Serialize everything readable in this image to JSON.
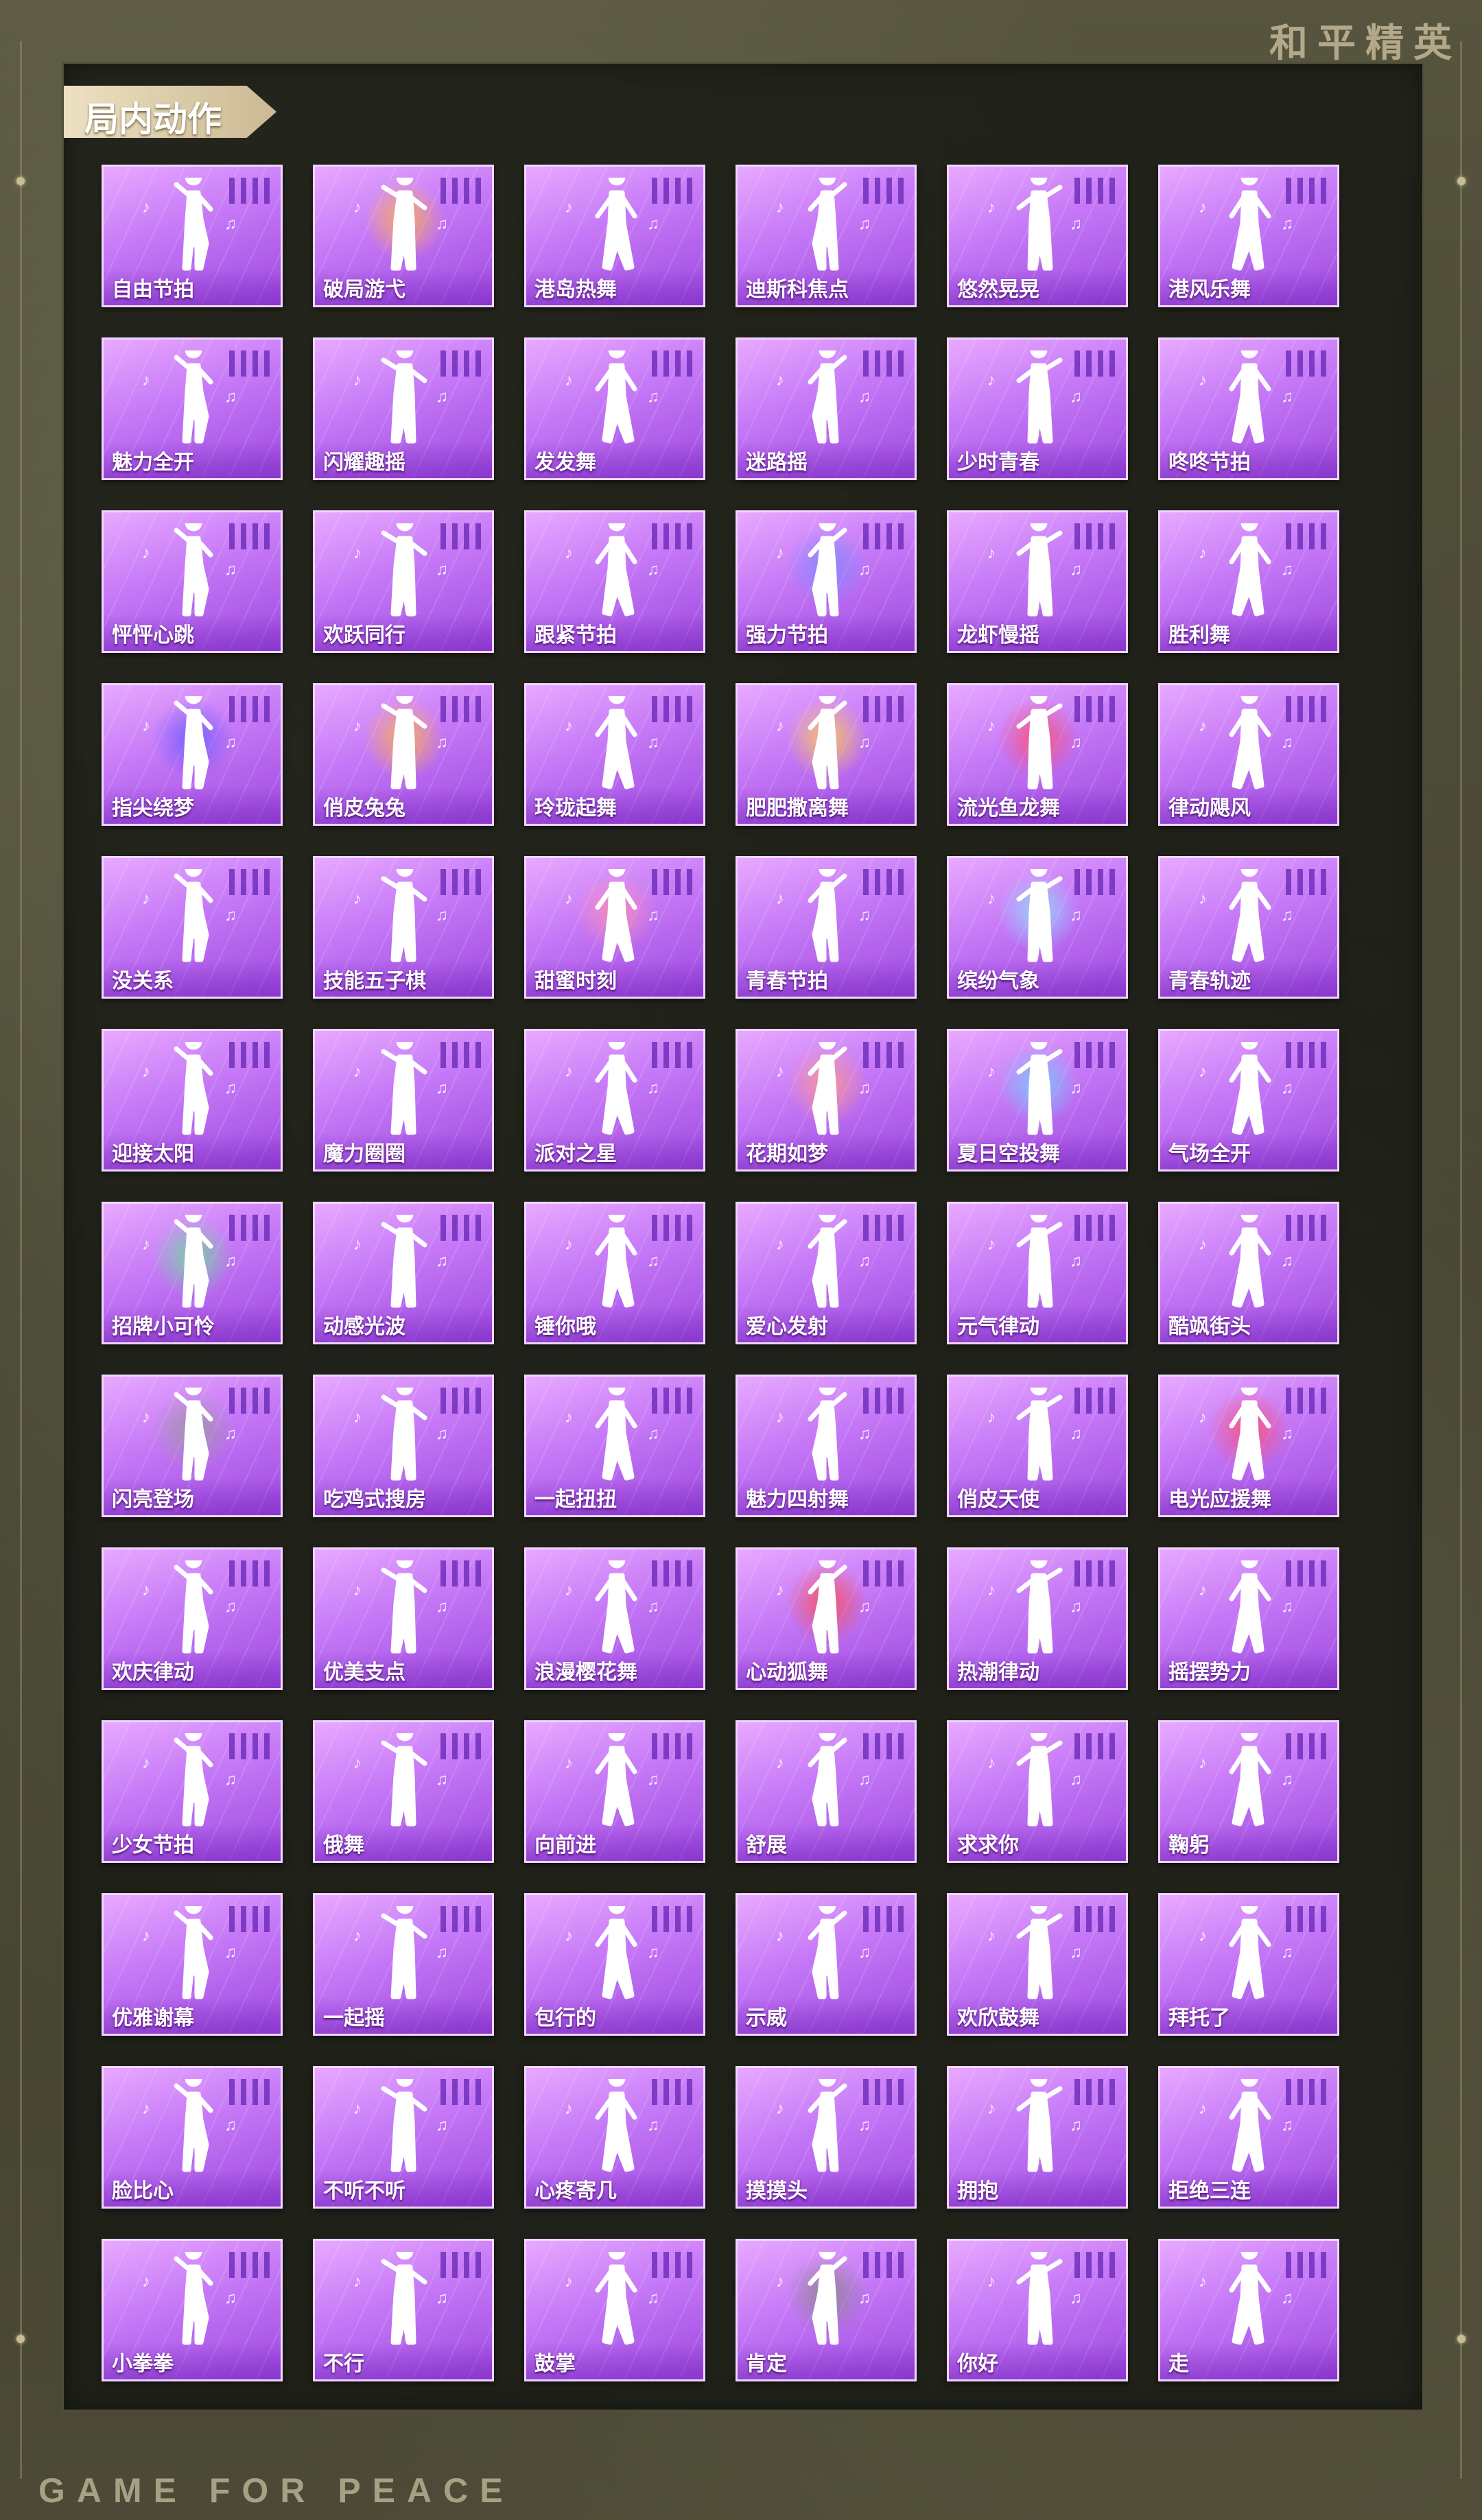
{
  "brand": {
    "title": "和平精英",
    "footer": "GAME FOR PEACE"
  },
  "section": {
    "title": "局内动作"
  },
  "emotes": [
    "自由节拍",
    "破局游弋",
    "港岛热舞",
    "迪斯科焦点",
    "悠然晃晃",
    "港风乐舞",
    "魅力全开",
    "闪耀趣摇",
    "发发舞",
    "迷路摇",
    "少时青春",
    "咚咚节拍",
    "怦怦心跳",
    "欢跃同行",
    "跟紧节拍",
    "强力节拍",
    "龙虾慢摇",
    "胜利舞",
    "指尖绕梦",
    "俏皮兔兔",
    "玲珑起舞",
    "肥肥撒离舞",
    "流光鱼龙舞",
    "律动飓风",
    "没关系",
    "技能五子棋",
    "甜蜜时刻",
    "青春节拍",
    "缤纷气象",
    "青春轨迹",
    "迎接太阳",
    "魔力圈圈",
    "派对之星",
    "花期如梦",
    "夏日空投舞",
    "气场全开",
    "招牌小可怜",
    "动感光波",
    "锤你哦",
    "爱心发射",
    "元气律动",
    "酷飒街头",
    "闪亮登场",
    "吃鸡式搜房",
    "一起扭扭",
    "魅力四射舞",
    "俏皮天使",
    "电光应援舞",
    "欢庆律动",
    "优美支点",
    "浪漫樱花舞",
    "心动狐舞",
    "热潮律动",
    "摇摆势力",
    "少女节拍",
    "俄舞",
    "向前进",
    "舒展",
    "求求你",
    "鞠躬",
    "优雅谢幕",
    "一起摇",
    "包行的",
    "示威",
    "欢欣鼓舞",
    "拜托了",
    "脸比心",
    "不听不听",
    "心疼寄几",
    "摸摸头",
    "拥抱",
    "拒绝三连",
    "小拳拳",
    "不行",
    "鼓掌",
    "肯定",
    "你好",
    "走"
  ],
  "effects": {
    "1": "#ffb347",
    "15": "#7b8cff",
    "18": "#6b5cff",
    "19": "#ffb347",
    "21": "#ffcf4d",
    "22": "#ff4d6d",
    "26": "#ff8fb3",
    "28": "#8fe0ff",
    "33": "#ff9a8a",
    "34": "#6fd0ff",
    "36": "#6adf9a",
    "42": "#9a9a9a",
    "47": "#ff4d6d",
    "51": "#ff4d4d",
    "75": "#888888"
  },
  "colors": {
    "card_border": "#f1d5ff",
    "card_top": "#e8a9ff",
    "card_bottom": "#9d49de",
    "title_tag": "#ece1c2"
  }
}
